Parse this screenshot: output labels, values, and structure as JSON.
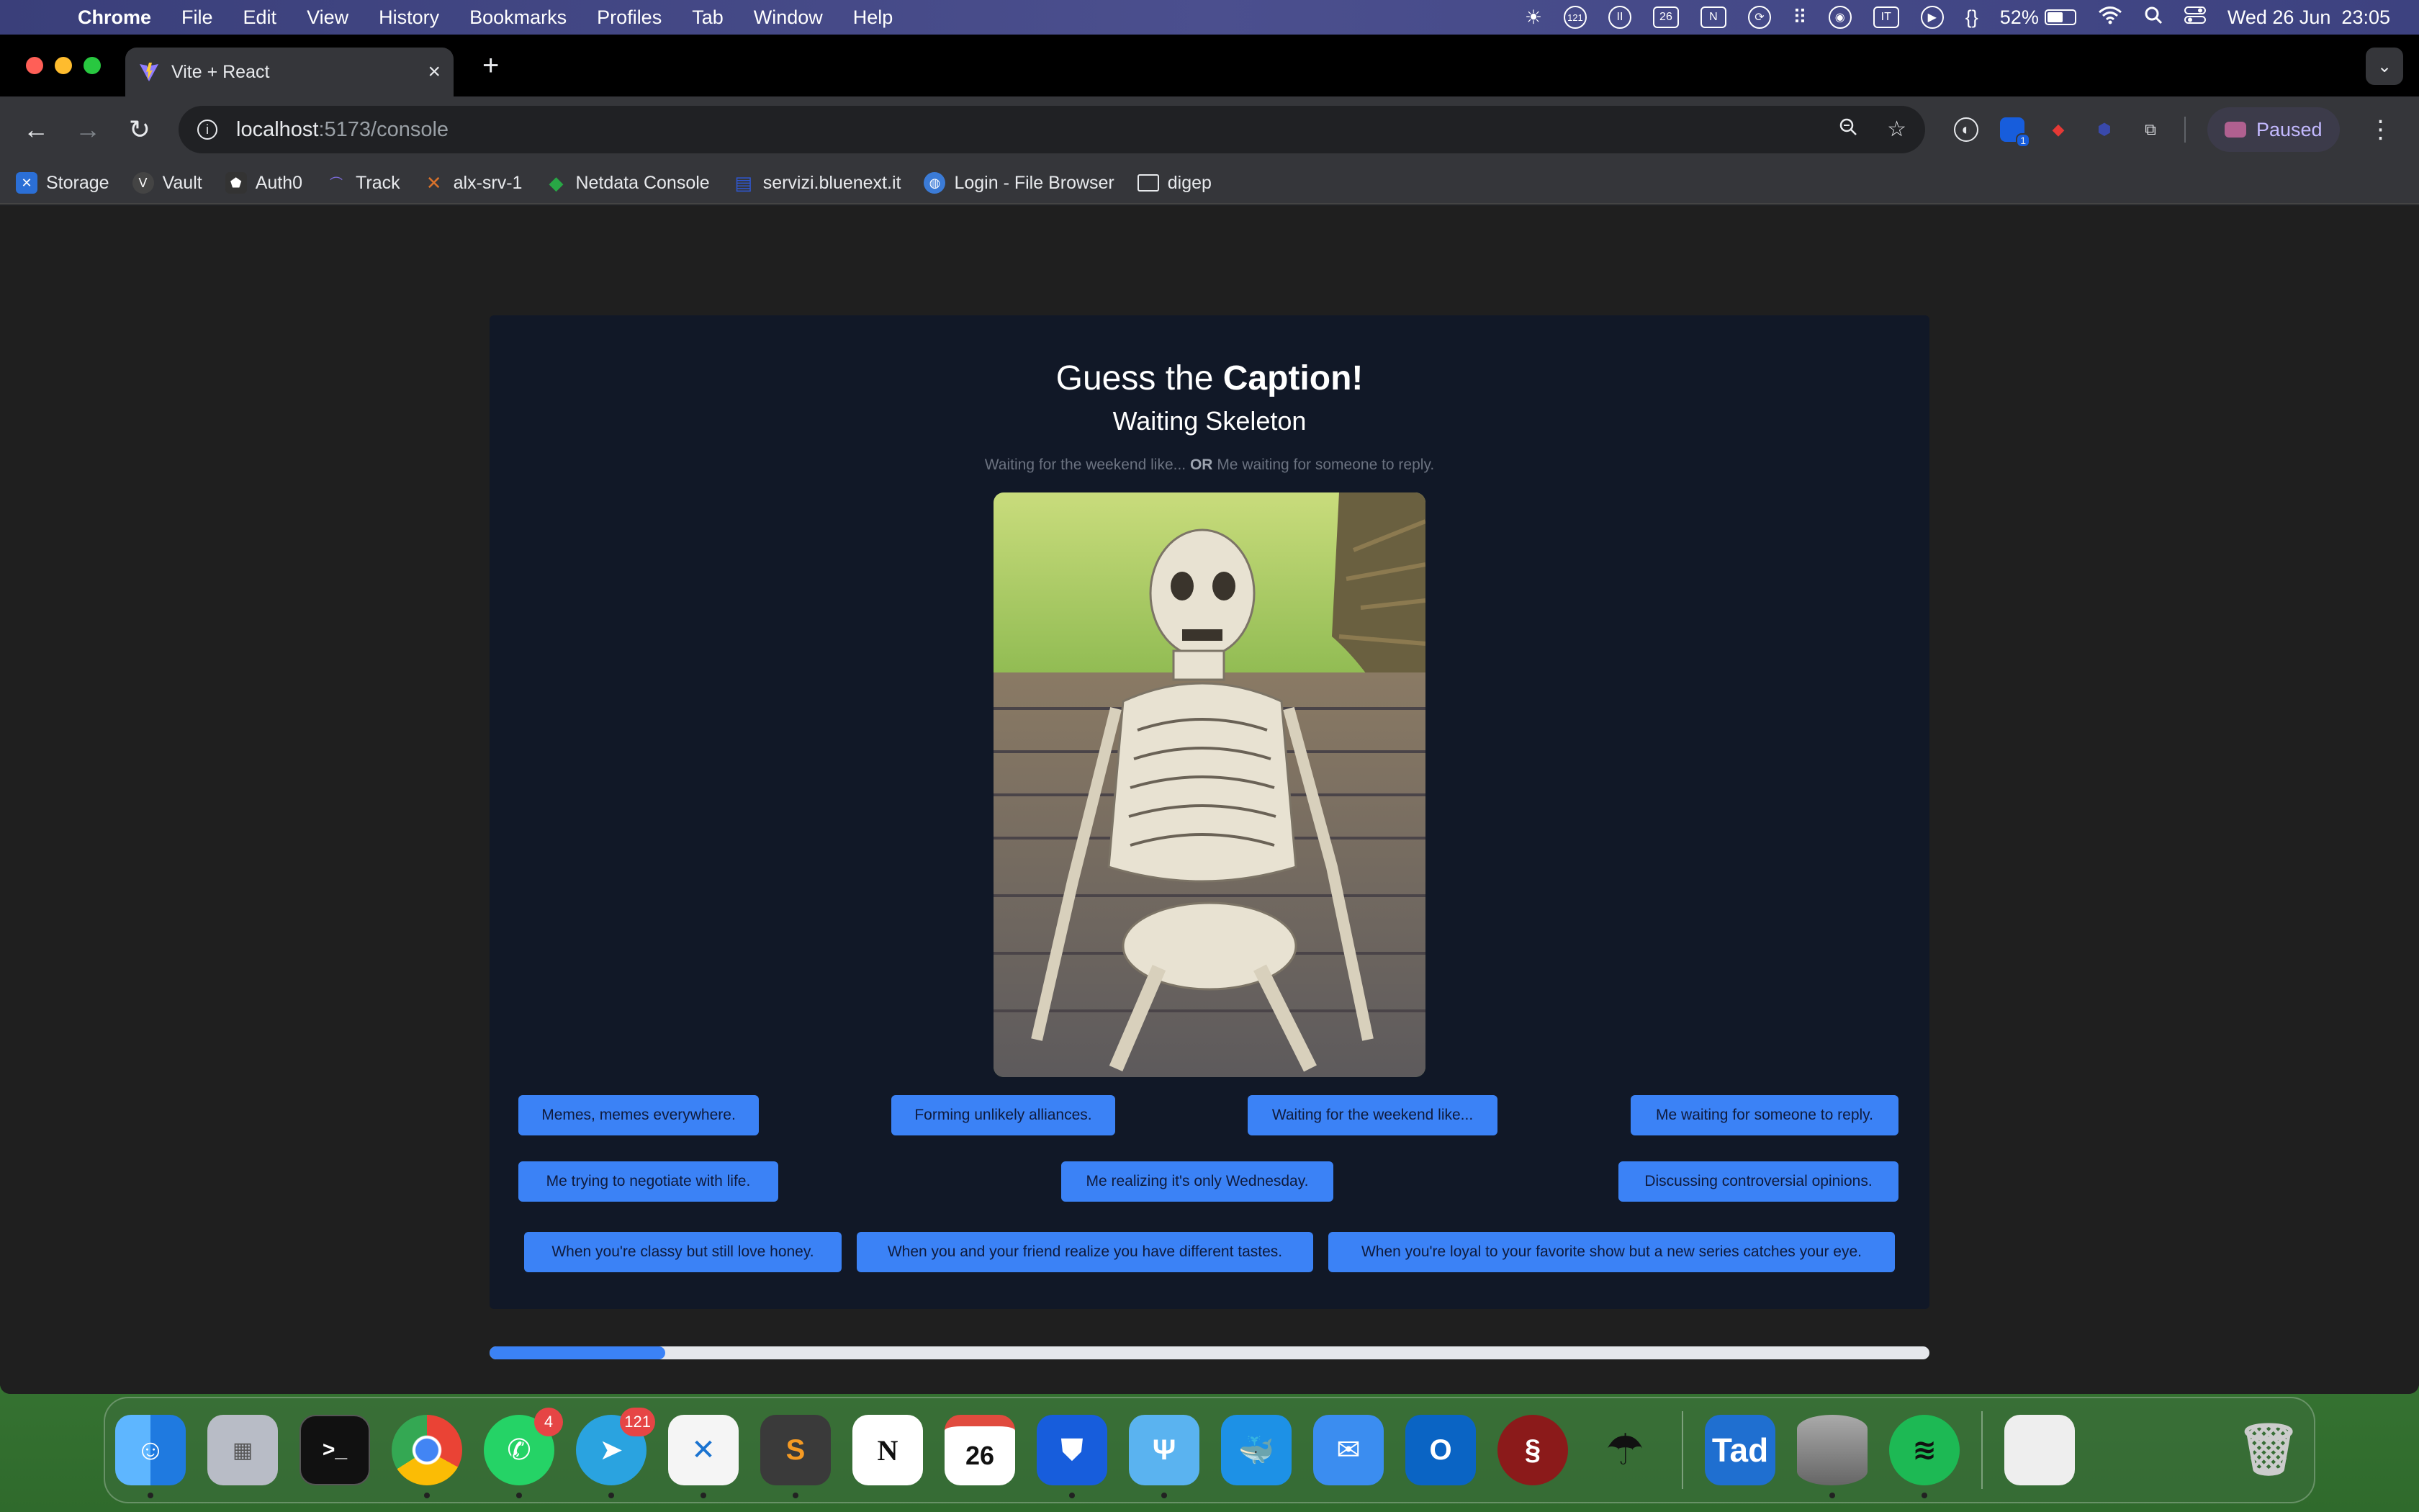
{
  "menubar": {
    "app_name": "Chrome",
    "menus": [
      "File",
      "Edit",
      "View",
      "History",
      "Bookmarks",
      "Profiles",
      "Tab",
      "Window",
      "Help"
    ],
    "status": {
      "notifications_badge": "121",
      "calendar_day": "26",
      "notion_letter": "N",
      "input_source": "IT",
      "braces": "{}",
      "battery": "52%",
      "datetime": "Wed 26 Jun  23:05"
    }
  },
  "browser": {
    "tab_title": "Vite + React",
    "url_host": "localhost",
    "url_path": ":5173/console",
    "extension_badge": "1",
    "profile_status": "Paused",
    "bookmarks": [
      {
        "label": "Storage",
        "icon": "storage-icon",
        "color": "#2b6fd6"
      },
      {
        "label": "Vault",
        "icon": "vault-icon",
        "color": "#444444"
      },
      {
        "label": "Auth0",
        "icon": "shield-icon",
        "color": "#333333"
      },
      {
        "label": "Track",
        "icon": "track-icon",
        "color": "#7b6bd9"
      },
      {
        "label": "alx-srv-1",
        "icon": "x-icon",
        "color": "#d9722b"
      },
      {
        "label": "Netdata Console",
        "icon": "netdata-icon",
        "color": "#28a745"
      },
      {
        "label": "servizi.bluenext.it",
        "icon": "document-icon",
        "color": "#2f58d6"
      },
      {
        "label": "Login - File Browser",
        "icon": "globe-icon",
        "color": "#3b7bd6"
      },
      {
        "label": "digep",
        "icon": "folder-icon",
        "color": "#35363a"
      }
    ]
  },
  "game": {
    "title_prefix": "Guess the ",
    "title_bold": "Caption!",
    "subtitle": "Waiting Skeleton",
    "hint_left": "Waiting for the weekend like...",
    "hint_or": "OR",
    "hint_right": "Me waiting for someone to reply.",
    "options": [
      "Memes, memes everywhere.",
      "Forming unlikely alliances.",
      "Waiting for the weekend like...",
      "Me waiting for someone to reply.",
      "Me trying to negotiate with life.",
      "Me realizing it's only Wednesday.",
      "Discussing controversial opinions.",
      "When you're classy but still love honey.",
      "When you and your friend realize you have different tastes.",
      "When you're loyal to your favorite show but a new series catches your eye."
    ],
    "progress_fraction": 0.122,
    "accent": "#3b82f6"
  },
  "dock": {
    "whatsapp_badge": "4",
    "telegram_badge": "121",
    "calendar_day": "26",
    "tad_label": "Tad",
    "notion_letter": "N"
  }
}
